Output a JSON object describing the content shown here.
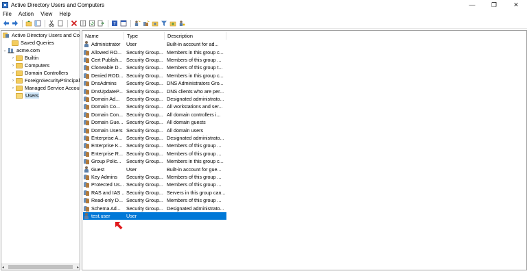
{
  "window": {
    "title": "Active Directory Users and Computers",
    "controls": {
      "minimize": "—",
      "maximize": "❐",
      "close": "✕"
    }
  },
  "menu": [
    "File",
    "Action",
    "View",
    "Help"
  ],
  "toolbar": {
    "icons": [
      "back-icon",
      "forward-icon",
      "up-folder-icon",
      "show-tree-icon",
      "cut-icon",
      "copy-icon",
      "delete-icon",
      "properties-icon",
      "refresh-icon",
      "export-icon",
      "help-icon",
      "console-icon",
      "new-user-icon",
      "new-group-icon",
      "new-ou-icon",
      "filter-icon",
      "add-to-group-icon",
      "delegate-icon"
    ]
  },
  "tree": {
    "root": "Active Directory Users and Com",
    "items": [
      {
        "label": "Saved Queries",
        "level": 1
      },
      {
        "label": "acme.com",
        "level": 1
      },
      {
        "label": "Builtin",
        "level": 2
      },
      {
        "label": "Computers",
        "level": 2
      },
      {
        "label": "Domain Controllers",
        "level": 2
      },
      {
        "label": "ForeignSecurityPrincipals",
        "level": 2
      },
      {
        "label": "Managed Service Accour",
        "level": 2
      },
      {
        "label": "Users",
        "level": 2,
        "selected": true
      }
    ]
  },
  "list": {
    "columns": [
      "Name",
      "Type",
      "Description"
    ],
    "rows": [
      {
        "name": "Administrator",
        "type": "User",
        "desc": "Built-in account for ad...",
        "icon": "user"
      },
      {
        "name": "Allowed RO...",
        "type": "Security Group...",
        "desc": "Members in this group c...",
        "icon": "group"
      },
      {
        "name": "Cert Publish...",
        "type": "Security Group...",
        "desc": "Members of this group ...",
        "icon": "group"
      },
      {
        "name": "Cloneable D...",
        "type": "Security Group...",
        "desc": "Members of this group t...",
        "icon": "group"
      },
      {
        "name": "Denied ROD...",
        "type": "Security Group...",
        "desc": "Members in this group c...",
        "icon": "group"
      },
      {
        "name": "DnsAdmins",
        "type": "Security Group...",
        "desc": "DNS Administrators Gro...",
        "icon": "group"
      },
      {
        "name": "DnsUpdateP...",
        "type": "Security Group...",
        "desc": "DNS clients who are per...",
        "icon": "group"
      },
      {
        "name": "Domain Ad...",
        "type": "Security Group...",
        "desc": "Designated administrato...",
        "icon": "group"
      },
      {
        "name": "Domain Co...",
        "type": "Security Group...",
        "desc": "All workstations and ser...",
        "icon": "group"
      },
      {
        "name": "Domain Con...",
        "type": "Security Group...",
        "desc": "All domain controllers i...",
        "icon": "group"
      },
      {
        "name": "Domain Gue...",
        "type": "Security Group...",
        "desc": "All domain guests",
        "icon": "group"
      },
      {
        "name": "Domain Users",
        "type": "Security Group...",
        "desc": "All domain users",
        "icon": "group"
      },
      {
        "name": "Enterprise A...",
        "type": "Security Group...",
        "desc": "Designated administrato...",
        "icon": "group"
      },
      {
        "name": "Enterprise K...",
        "type": "Security Group...",
        "desc": "Members of this group ...",
        "icon": "group"
      },
      {
        "name": "Enterprise R...",
        "type": "Security Group...",
        "desc": "Members of this group ...",
        "icon": "group"
      },
      {
        "name": "Group Polic...",
        "type": "Security Group...",
        "desc": "Members in this group c...",
        "icon": "group"
      },
      {
        "name": "Guest",
        "type": "User",
        "desc": "Built-in account for gue...",
        "icon": "user"
      },
      {
        "name": "Key Admins",
        "type": "Security Group...",
        "desc": "Members of this group ...",
        "icon": "group"
      },
      {
        "name": "Protected Us...",
        "type": "Security Group...",
        "desc": "Members of this group ...",
        "icon": "group"
      },
      {
        "name": "RAS and IAS ...",
        "type": "Security Group...",
        "desc": "Servers in this group can...",
        "icon": "group"
      },
      {
        "name": "Read-only D...",
        "type": "Security Group...",
        "desc": "Members of this group ...",
        "icon": "group"
      },
      {
        "name": "Schema Ad...",
        "type": "Security Group...",
        "desc": "Designated administrato...",
        "icon": "group"
      },
      {
        "name": "test.user",
        "type": "User",
        "desc": "",
        "icon": "user",
        "selected": true
      }
    ]
  },
  "colors": {
    "selection": "#0078d7",
    "tree_selection": "#cce4f7",
    "annotation_arrow": "#e0191c"
  }
}
